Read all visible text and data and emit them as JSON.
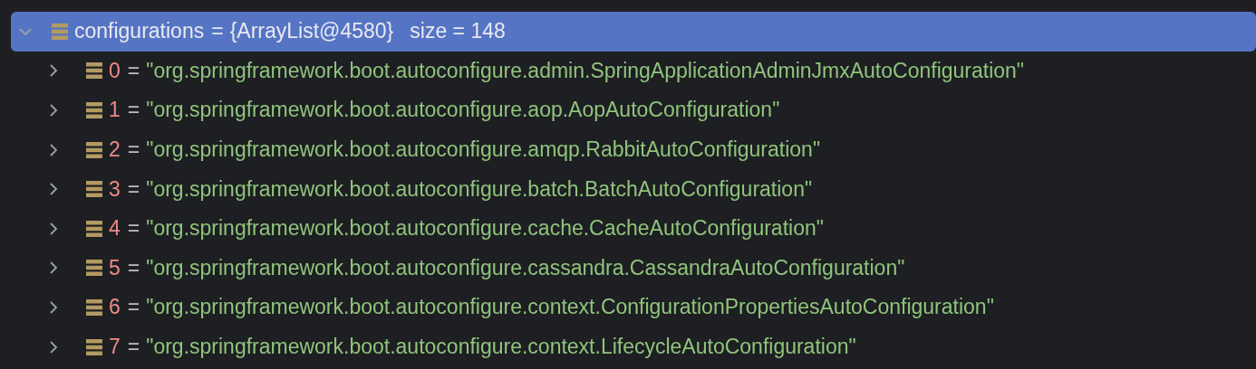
{
  "tree": [
    {
      "name": "configurations",
      "op": "=",
      "value": "{ArrayList@4580}",
      "extra": "size = 148",
      "selected": true,
      "expanded": true,
      "children": [
        {
          "name": "0",
          "op": "=",
          "value": "\"org.springframework.boot.autoconfigure.admin.SpringApplicationAdminJmxAutoConfiguration\"",
          "selected": false,
          "expanded": false
        },
        {
          "name": "1",
          "op": "=",
          "value": "\"org.springframework.boot.autoconfigure.aop.AopAutoConfiguration\"",
          "selected": false,
          "expanded": false
        },
        {
          "name": "2",
          "op": "=",
          "value": "\"org.springframework.boot.autoconfigure.amqp.RabbitAutoConfiguration\"",
          "selected": false,
          "expanded": false
        },
        {
          "name": "3",
          "op": "=",
          "value": "\"org.springframework.boot.autoconfigure.batch.BatchAutoConfiguration\"",
          "selected": false,
          "expanded": false
        },
        {
          "name": "4",
          "op": "=",
          "value": "\"org.springframework.boot.autoconfigure.cache.CacheAutoConfiguration\"",
          "selected": false,
          "expanded": false
        },
        {
          "name": "5",
          "op": "=",
          "value": "\"org.springframework.boot.autoconfigure.cassandra.CassandraAutoConfiguration\"",
          "selected": false,
          "expanded": false
        },
        {
          "name": "6",
          "op": "=",
          "value": "\"org.springframework.boot.autoconfigure.context.ConfigurationPropertiesAutoConfiguration\"",
          "selected": false,
          "expanded": false
        },
        {
          "name": "7",
          "op": "=",
          "value": "\"org.springframework.boot.autoconfigure.context.LifecycleAutoConfiguration\"",
          "selected": false,
          "expanded": false
        }
      ]
    }
  ]
}
